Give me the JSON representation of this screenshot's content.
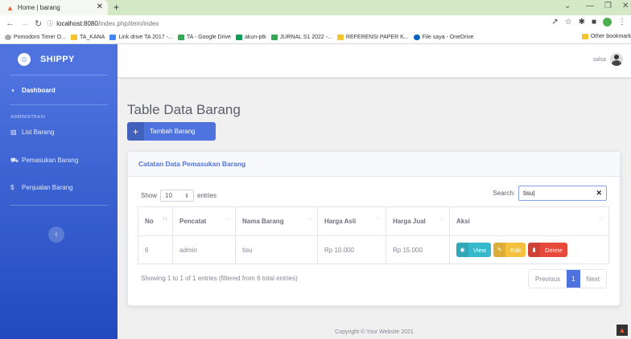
{
  "browser": {
    "tab_title": "Home | barang",
    "url_host": "localhost:8080",
    "url_path": "/index.php/item/index",
    "bookmarks": [
      {
        "label": "Pomodoro Timer O...",
        "color": "#aaaaaa"
      },
      {
        "label": "TA_KANA",
        "color": "#f4c430"
      },
      {
        "label": "Link drive TA 2017 -...",
        "color": "#4285f4"
      },
      {
        "label": "TA - Google Drive",
        "color": "#34a853"
      },
      {
        "label": "akun-ptk",
        "color": "#0f9d58"
      },
      {
        "label": "JURNAL S1 2022 -...",
        "color": "#34a853"
      },
      {
        "label": "REFERENSI PAPER K...",
        "color": "#f4c430"
      },
      {
        "label": "File saya - OneDrive",
        "color": "#0364b8"
      }
    ],
    "other_bookmarks": "Other bookmark"
  },
  "sidebar": {
    "brand": "SHIPPY",
    "dashboard": "Dashboard",
    "heading": "ADMINISTRASI",
    "items": [
      {
        "label": "List Barang",
        "icon": "clipboard-icon"
      },
      {
        "label": "Pemasukan Barang",
        "icon": "truck-icon"
      },
      {
        "label": "Penjualan Barang",
        "icon": "dollar-icon"
      }
    ]
  },
  "topbar": {
    "user": "salsa"
  },
  "main": {
    "title": "Table Data Barang",
    "add_button": "Tambah Barang",
    "card_title": "Catatan Data Pemasukan Barang",
    "show": "Show",
    "entries_value": "10",
    "entries": "entries",
    "search_label": "Search:",
    "search_value": "tisu",
    "columns": [
      "No",
      "Pencatat",
      "Nama Barang",
      "Harga Asli",
      "Harga Jual",
      "Aksi"
    ],
    "rows": [
      {
        "no": "6",
        "pencatat": "admin",
        "nama": "tisu",
        "asli": "Rp 10.000",
        "jual": "Rp 15.000"
      }
    ],
    "actions": {
      "view": "View",
      "edit": "Edit",
      "delete": "Delete"
    },
    "info": "Showing 1 to 1 of 1 entries (filtered from 6 total entries)",
    "pager": {
      "prev": "Previous",
      "page": "1",
      "next": "Next"
    },
    "footer": "Copyright © Your Website 2021"
  }
}
